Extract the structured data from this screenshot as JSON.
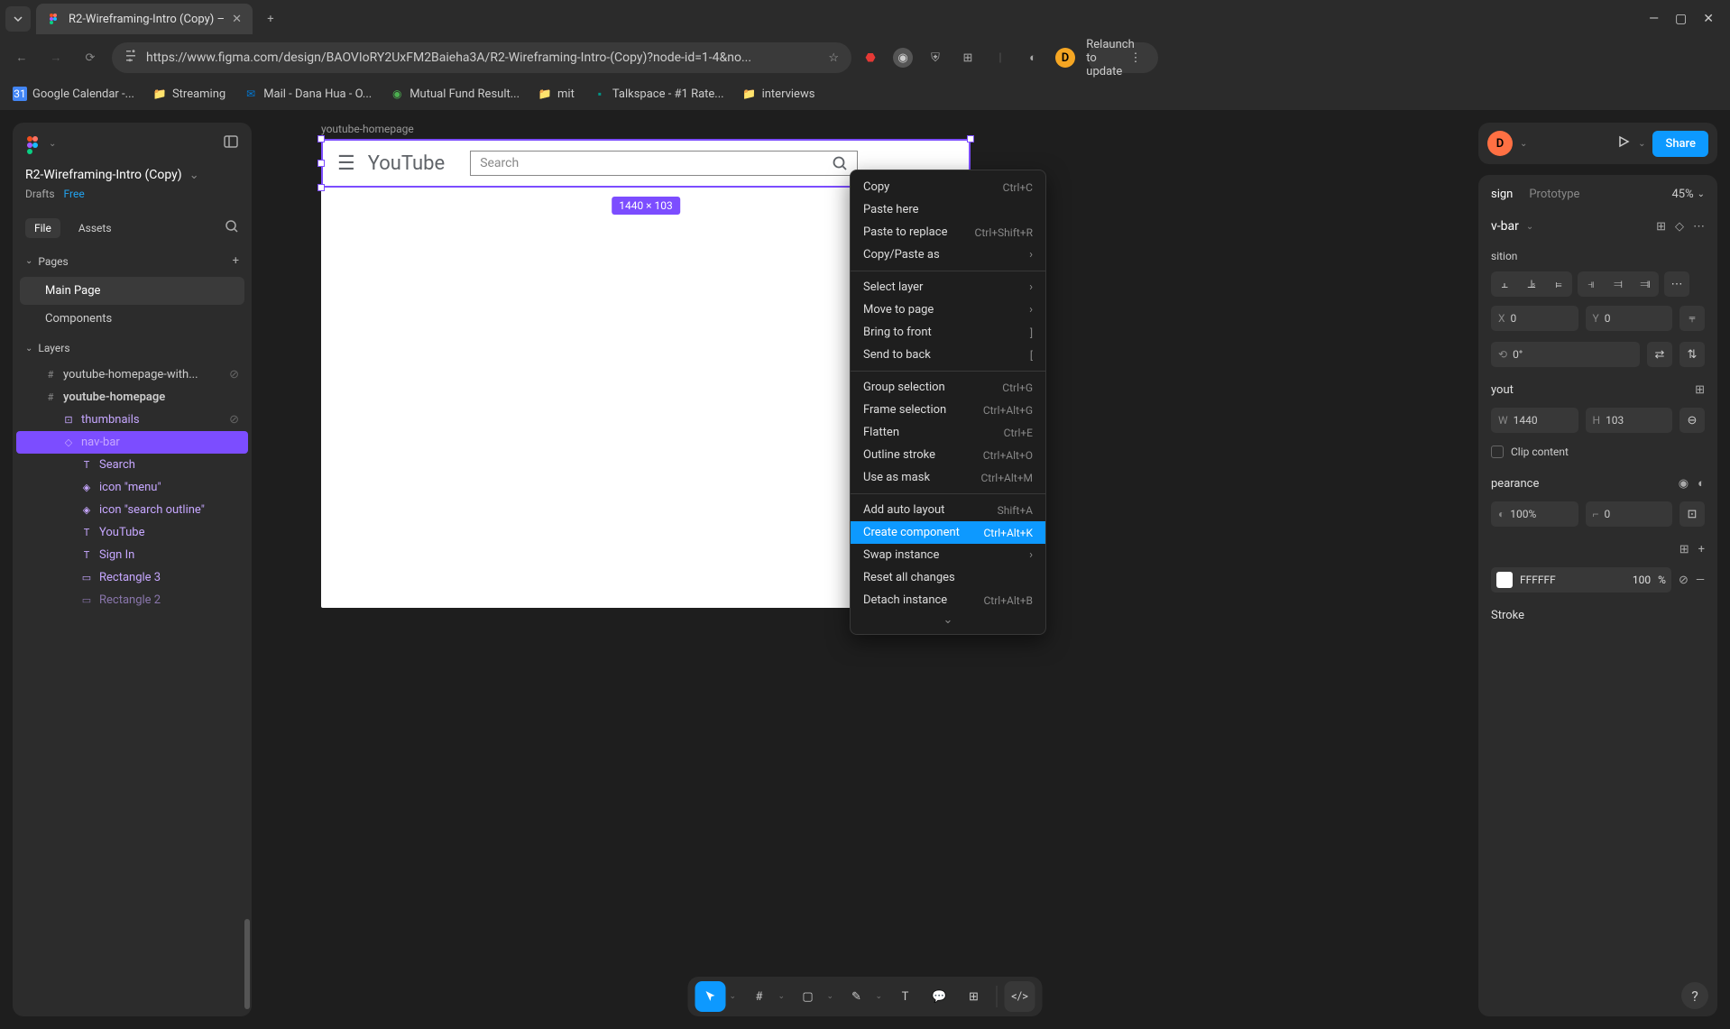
{
  "browser": {
    "tab_title": "R2-Wireframing-Intro (Copy) – ",
    "url": "https://www.figma.com/design/BAOVIoRY2UxFM2Baieha3A/R2-Wireframing-Intro-(Copy)?node-id=1-4&no...",
    "relaunch": "Relaunch to update",
    "avatar": "D",
    "bookmarks": [
      "Google Calendar -...",
      "Streaming",
      "Mail - Dana Hua - O...",
      "Mutual Fund Result...",
      "mit",
      "Talkspace - #1 Rate...",
      "interviews"
    ]
  },
  "left": {
    "file_title": "R2-Wireframing-Intro (Copy)",
    "drafts": "Drafts",
    "free": "Free",
    "tab_file": "File",
    "tab_assets": "Assets",
    "pages_title": "Pages",
    "page_main": "Main Page",
    "page_components": "Components",
    "layers_title": "Layers",
    "layers": {
      "yt_with": "youtube-homepage-with...",
      "yt": "youtube-homepage",
      "thumbnails": "thumbnails",
      "navbar": "nav-bar",
      "search": "Search",
      "icon_menu": "icon \"menu\"",
      "icon_search": "icon \"search outline\"",
      "youtube": "YouTube",
      "signin": "Sign In",
      "rect3": "Rectangle 3",
      "rect2": "Rectangle 2"
    }
  },
  "canvas": {
    "frame_label": "youtube-homepage",
    "yt_label": "YouTube",
    "search_placeholder": "Search",
    "dim_badge": "1440 × 103"
  },
  "topright": {
    "user": "D",
    "share": "Share"
  },
  "right": {
    "tab_design": "sign",
    "tab_design_full": "Design",
    "tab_prototype": "Prototype",
    "zoom": "45%",
    "sel_name": "v-bar",
    "position_title": "sition",
    "x": "0",
    "y": "0",
    "rotation": "0°",
    "layout_title": "yout",
    "w": "1440",
    "h": "103",
    "clip": "Clip content",
    "appearance_title": "pearance",
    "opacity": "100%",
    "radius": "0",
    "fill_hex": "FFFFFF",
    "fill_pct": "100",
    "fill_unit": "%",
    "stroke_title": "Stroke"
  },
  "context_menu": {
    "copy": "Copy",
    "copy_s": "Ctrl+C",
    "paste_here": "Paste here",
    "paste_replace": "Paste to replace",
    "paste_replace_s": "Ctrl+Shift+R",
    "copy_paste_as": "Copy/Paste as",
    "select_layer": "Select layer",
    "move_to_page": "Move to page",
    "bring_front": "Bring to front",
    "bring_front_s": "]",
    "send_back": "Send to back",
    "send_back_s": "[",
    "group": "Group selection",
    "group_s": "Ctrl+G",
    "frame": "Frame selection",
    "frame_s": "Ctrl+Alt+G",
    "flatten": "Flatten",
    "flatten_s": "Ctrl+E",
    "outline": "Outline stroke",
    "outline_s": "Ctrl+Alt+O",
    "mask": "Use as mask",
    "mask_s": "Ctrl+Alt+M",
    "auto_layout": "Add auto layout",
    "auto_layout_s": "Shift+A",
    "create_comp": "Create component",
    "create_comp_s": "Ctrl+Alt+K",
    "swap": "Swap instance",
    "reset": "Reset all changes",
    "detach": "Detach instance",
    "detach_s": "Ctrl+Alt+B"
  }
}
